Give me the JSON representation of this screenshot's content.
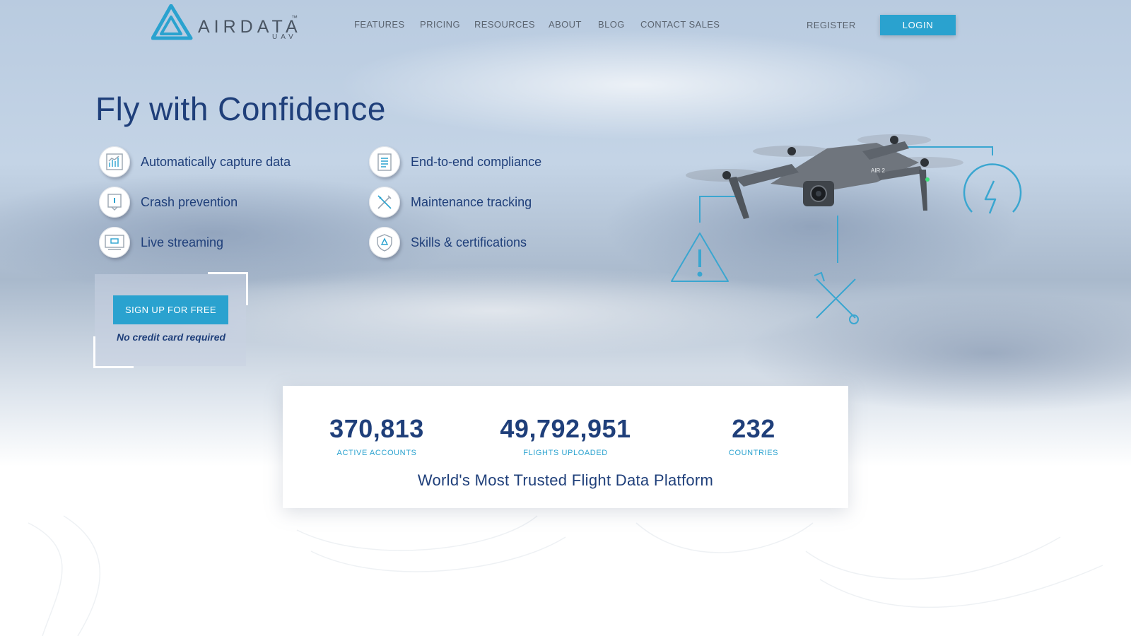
{
  "brand": {
    "name": "AIRDATA",
    "sub": "UAV",
    "trademark": "™"
  },
  "nav": {
    "items": [
      {
        "label": "FEATURES"
      },
      {
        "label": "PRICING"
      },
      {
        "label": "RESOURCES"
      },
      {
        "label": "ABOUT"
      },
      {
        "label": "BLOG"
      },
      {
        "label": "CONTACT SALES"
      }
    ],
    "register": "REGISTER",
    "login": "LOGIN"
  },
  "hero": {
    "title": "Fly with Confidence",
    "features": [
      {
        "label": "Automatically capture data",
        "icon": "bar-chart-icon"
      },
      {
        "label": "Crash prevention",
        "icon": "warning-icon"
      },
      {
        "label": "Live streaming",
        "icon": "streaming-icon"
      },
      {
        "label": "End-to-end compliance",
        "icon": "clipboard-icon"
      },
      {
        "label": "Maintenance tracking",
        "icon": "wrench-icon"
      },
      {
        "label": "Skills & certifications",
        "icon": "shield-icon"
      }
    ],
    "cta": {
      "signup": "SIGN UP FOR FREE",
      "note": "No credit card required"
    },
    "drone_label": "AIR 2"
  },
  "stats": {
    "items": [
      {
        "value": "370,813",
        "label": "ACTIVE ACCOUNTS"
      },
      {
        "value": "49,792,951",
        "label": "FLIGHTS UPLOADED"
      },
      {
        "value": "232",
        "label": "COUNTRIES"
      }
    ],
    "tagline": "World's Most Trusted Flight Data Platform"
  },
  "colors": {
    "accent": "#2aa2cf",
    "primary_text": "#1f3f7a",
    "nav_text": "#5b6470"
  }
}
